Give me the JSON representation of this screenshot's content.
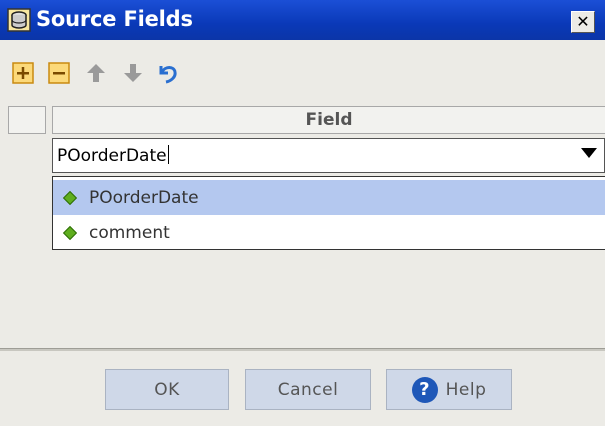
{
  "window": {
    "title": "Source Fields",
    "close_glyph": "✕"
  },
  "toolbar": {
    "buttons": [
      {
        "name": "add-icon"
      },
      {
        "name": "remove-icon"
      },
      {
        "name": "move-up-icon"
      },
      {
        "name": "move-down-icon"
      },
      {
        "name": "undo-icon"
      }
    ]
  },
  "table": {
    "column_header": "Field",
    "edit_value": "POorderDate"
  },
  "dropdown": {
    "items": [
      {
        "label": "POorderDate",
        "selected": true
      },
      {
        "label": "comment",
        "selected": false
      }
    ]
  },
  "footer": {
    "ok_label": "OK",
    "cancel_label": "Cancel",
    "help_label": "Help",
    "help_glyph": "?"
  },
  "colors": {
    "titlebar": "#0a39b8",
    "selected_row": "#b4c8ef",
    "button_bg": "#cfd8e8",
    "diamond": "#5fae1e"
  }
}
